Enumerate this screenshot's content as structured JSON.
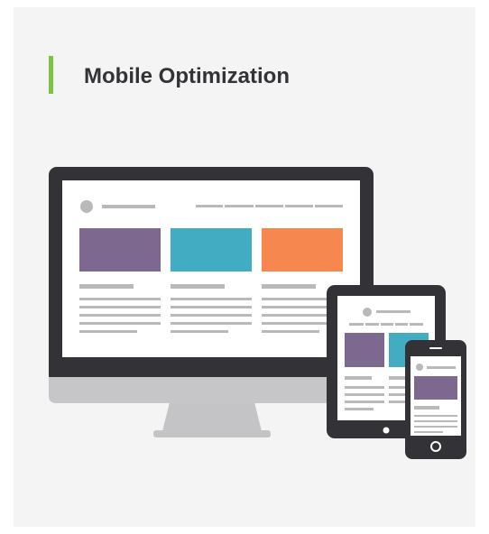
{
  "header": {
    "title": "Mobile Optimization"
  },
  "colors": {
    "accent": "#7dc242",
    "block_purple": "#7d6990",
    "block_teal": "#42acc3",
    "block_orange": "#f5874f",
    "device_frame": "#333236",
    "placeholder": "#b9b9bb",
    "stand": "#c4c4c6"
  },
  "illustration": {
    "devices": [
      "desktop-monitor",
      "tablet",
      "smartphone"
    ]
  }
}
